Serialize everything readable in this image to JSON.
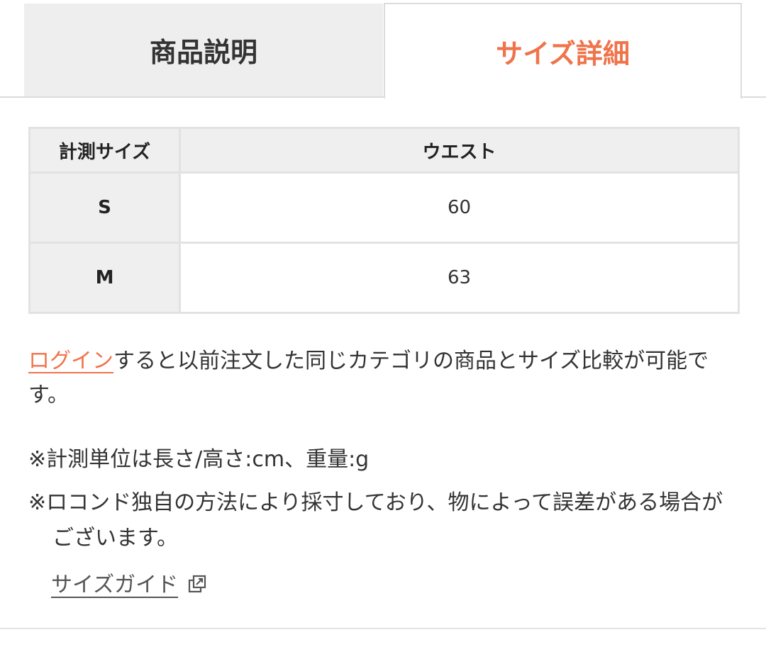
{
  "tabs": [
    {
      "label": "商品説明",
      "active": false
    },
    {
      "label": "サイズ詳細",
      "active": true
    }
  ],
  "size_table": {
    "headers": [
      "計測サイズ",
      "ウエスト"
    ],
    "rows": [
      {
        "size": "S",
        "waist": "60"
      },
      {
        "size": "M",
        "waist": "63"
      }
    ]
  },
  "login_note": {
    "link_text": "ログイン",
    "text": "すると以前注文した同じカテゴリの商品とサイズ比較が可能です。"
  },
  "notes": {
    "unit": "※計測単位は長さ/高さ:cm、重量:g",
    "method": "※ロコンド独自の方法により採寸しており、物によって誤差がある場合がございます。"
  },
  "size_guide": {
    "label": "サイズガイド",
    "icon": "external-link-icon"
  },
  "colors": {
    "accent": "#f0734a",
    "tab_inactive_bg": "#eeeeee",
    "table_header_bg": "#efefef",
    "border": "#e2e2e2"
  }
}
